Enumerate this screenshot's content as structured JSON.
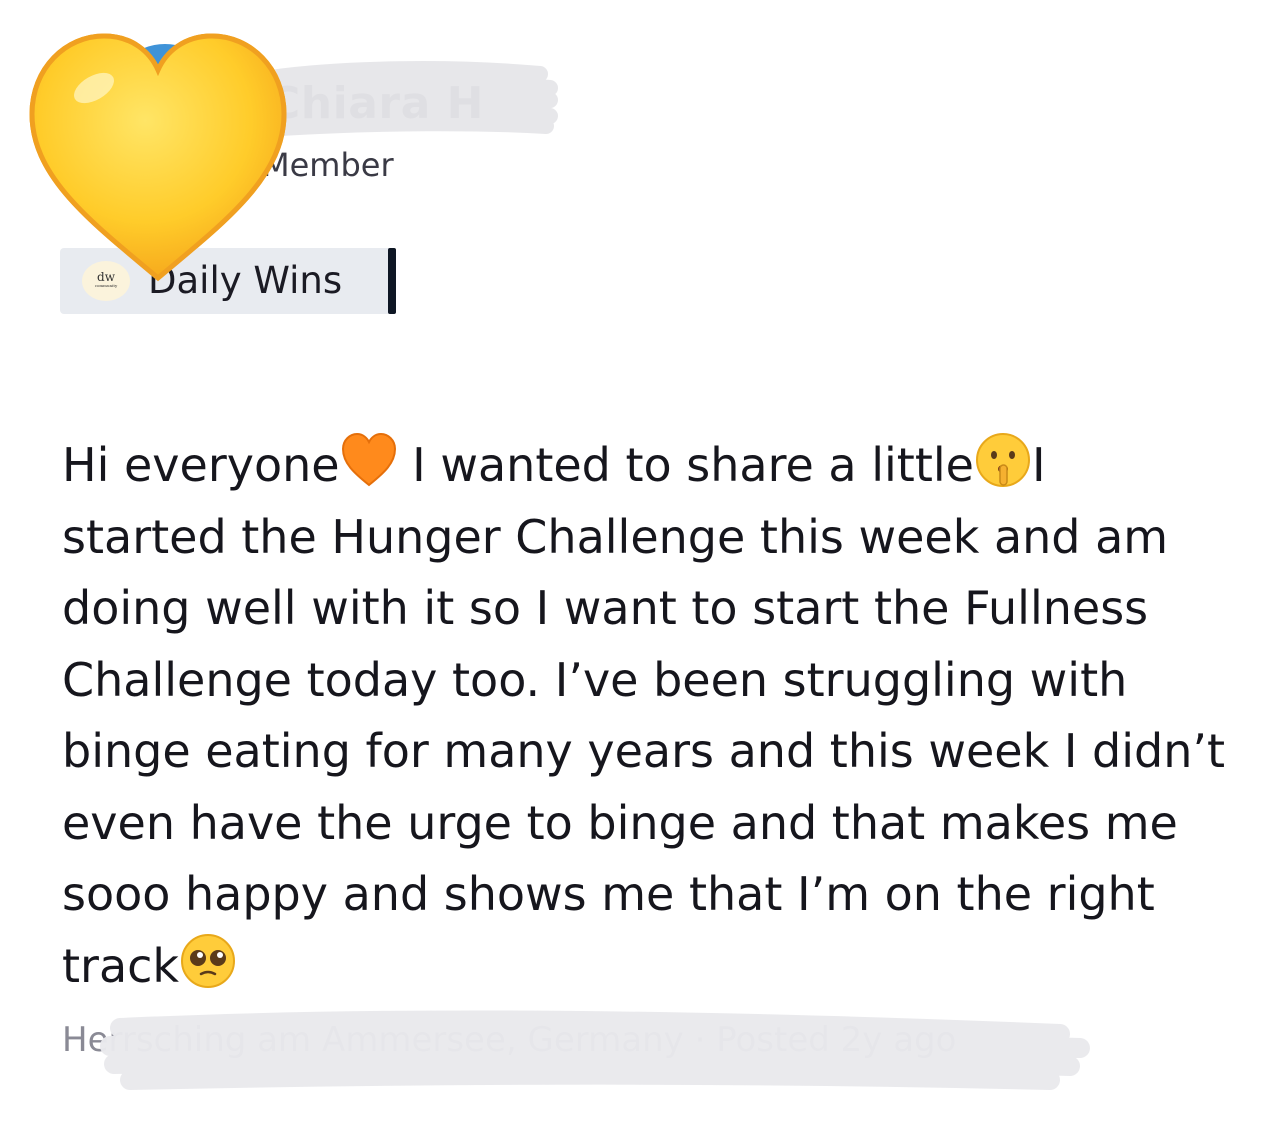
{
  "author": {
    "name": "Chiara H",
    "role": "Member",
    "avatar_color": "#3f93d8"
  },
  "overlay": {
    "emoji": "yellow-heart-icon",
    "color": "#ffcf2e"
  },
  "space": {
    "logo_text": "dw",
    "logo_subtext": "community",
    "name": "Daily Wins"
  },
  "post": {
    "line1_a": "Hi everyone",
    "line1_b": " I wanted to share a little",
    "line1_c": "I",
    "rest": "started the Hunger Challenge this week and am doing well with it so I want to start the Fullness Challenge today too. I’ve been struggling with binge eating for many years and this week I didn’t even have the urge to binge and that makes me sooo happy and shows me that I’m on the right track",
    "emojis": [
      "orange-heart-icon",
      "shushing-face-icon",
      "pleading-face-icon"
    ]
  },
  "meta": {
    "text": "Herrsching am Ammersee, Germany · Posted 2y ago"
  }
}
